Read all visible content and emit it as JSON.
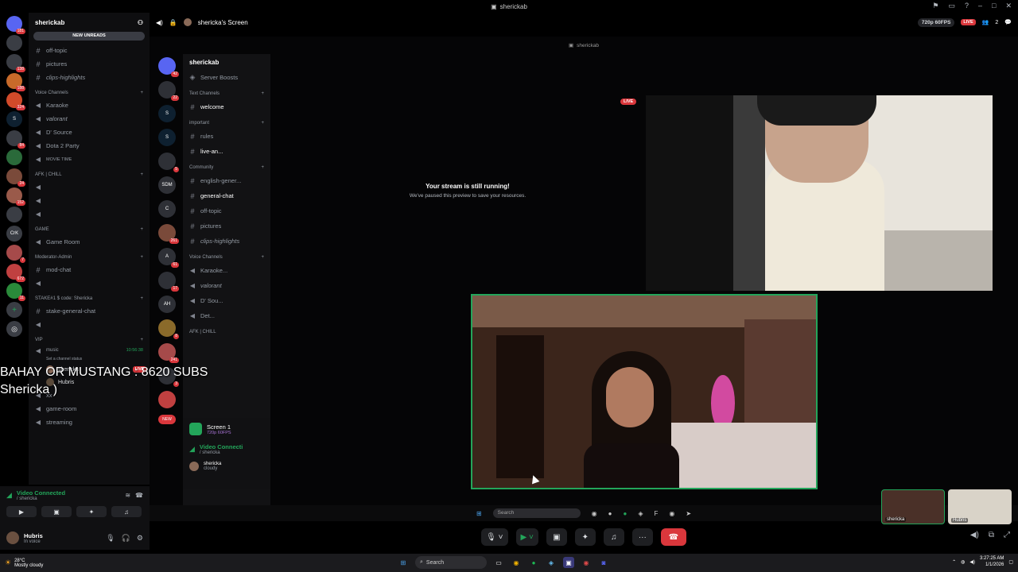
{
  "window": {
    "title": "sherickab"
  },
  "rail": {
    "badges": [
      "181",
      "",
      "138",
      "188",
      "324",
      "",
      "84",
      "",
      "24",
      "152",
      "",
      "",
      "7",
      "672",
      "11",
      "",
      ""
    ]
  },
  "sidebar": {
    "server_name": "sherickab",
    "new_unreads": "NEW UNREADS",
    "channels_top": [
      "off-topic",
      "pictures",
      "clips-highlights"
    ],
    "voice_cat": "Voice Channels",
    "voice_channels": [
      "Karaoke",
      "valorant",
      "D' Source",
      "Dota 2 Party",
      "MOVIE TIME"
    ],
    "afk_cat": "AFK | CHILL",
    "game_cat": "GAME",
    "game_room": "Game Room",
    "mod_cat": "Moderator-Admin",
    "mod_chat": "mod-chat",
    "stake_cat": "STAKE#1 $ code: Shericka",
    "stake_chat": "stake-general-chat",
    "vip_cat": "VIP",
    "music": "music",
    "channel_status": "Set a channel status",
    "timer": "10:56:38",
    "users": [
      {
        "name": "shericka",
        "live": "LIVE"
      },
      {
        "name": "Hubris"
      }
    ],
    "channels_bottom": [
      "xx",
      "game-room",
      "streaming"
    ]
  },
  "voice_panel": {
    "status": "Video Connected",
    "sub": "/ shericka"
  },
  "user_panel": {
    "name": "Hubris",
    "status": "In voice"
  },
  "stage": {
    "title": "shericka's Screen",
    "quality": "720p 60FPS",
    "live": "LIVE",
    "viewers": "2"
  },
  "share": {
    "window_title": "sherickab",
    "inner_server": "sherickab",
    "inner_badges": [
      "42",
      "22",
      "",
      "",
      "5",
      "",
      "",
      "261",
      "61",
      "17",
      "",
      "8",
      "241",
      "3",
      "",
      "NEW"
    ],
    "inner_channels": [
      "Server Boosts",
      "welcome",
      "rules",
      "live-an...",
      "english-gener...",
      "general-chat",
      "off-topic",
      "pictures",
      "clips-highlights",
      "Karaoke...",
      "valorant",
      "D' Sou...",
      "Det...",
      "AFK | CHILL"
    ],
    "inner_cats": {
      "text": "Text Channels",
      "important": "important",
      "community": "Community",
      "voice": "Voice Channels"
    },
    "screen_label": "Screen 1",
    "screen_sub": "720p 60FPS",
    "vc_label": "Video Connecti",
    "vc_sub": "/ shericka",
    "inner_user": "shericka",
    "inner_user_status": "cloudy",
    "paused_title": "Your stream is still running!",
    "paused_sub": "We've paused this preview to save your resources.",
    "live_tag": "LIVE",
    "inner_search": "Search"
  },
  "tiles": [
    {
      "name": "shericka"
    },
    {
      "name": "Hubris"
    }
  ],
  "overlay": {
    "line1": "BAHAY OR MUSTANG : 8620 SUBS",
    "line2": "Shericka )"
  },
  "taskbar": {
    "temp": "28°C",
    "weather": "Mostly cloudy",
    "search": "Search",
    "time": "3:27:25 AM",
    "date": "1/1/2026"
  }
}
